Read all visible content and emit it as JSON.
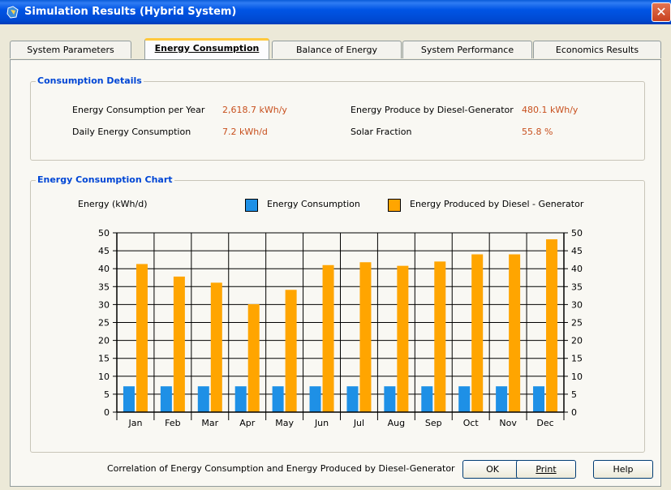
{
  "window": {
    "title": "Simulation Results (Hybrid System)"
  },
  "tabs": [
    "System Parameters",
    "Energy Consumption",
    "Balance of Energy",
    "System Performance",
    "Economics Results"
  ],
  "active_tab": 1,
  "consumption_details": {
    "title": "Consumption Details",
    "energy_per_year_label": "Energy Consumption per Year",
    "energy_per_year_value": "2,618.7  kWh/y",
    "daily_label": "Daily Energy Consumption",
    "daily_value": "7.2  kWh/d",
    "diesel_label": "Energy Produce by Diesel-Generator",
    "diesel_value": "480.1  kWh/y",
    "solar_label": "Solar Fraction",
    "solar_value": "55.8  %"
  },
  "chart_section": {
    "title": "Energy Consumption Chart",
    "ylabel": "Energy (kWh/d)",
    "legend_consumption": "Energy Consumption",
    "legend_diesel": "Energy Produced by Diesel - Generator"
  },
  "chart_data": {
    "type": "bar",
    "categories": [
      "Jan",
      "Feb",
      "Mar",
      "Apr",
      "May",
      "Jun",
      "Jul",
      "Aug",
      "Sep",
      "Oct",
      "Nov",
      "Dec"
    ],
    "series": [
      {
        "name": "Energy Consumption",
        "color": "#1e90e6",
        "values": [
          7.2,
          7.2,
          7.2,
          7.2,
          7.2,
          7.2,
          7.2,
          7.2,
          7.2,
          7.2,
          7.2,
          7.2
        ]
      },
      {
        "name": "Energy Produced by Diesel - Generator",
        "color": "#ffa500",
        "values": [
          41.3,
          37.8,
          36.1,
          30.1,
          34.1,
          41.0,
          41.8,
          40.8,
          42.0,
          44.0,
          44.0,
          48.2
        ]
      }
    ],
    "ylabel": "Energy (kWh/d)",
    "ylim": [
      0,
      50
    ],
    "yticks": [
      0,
      5,
      10,
      15,
      20,
      25,
      30,
      35,
      40,
      45,
      50
    ],
    "grid": true,
    "legend": "top"
  },
  "footer": {
    "caption": "Correlation of Energy Consumption and Energy Produced by Diesel-Generator",
    "ok": "OK",
    "print": "Print",
    "help": "Help"
  }
}
